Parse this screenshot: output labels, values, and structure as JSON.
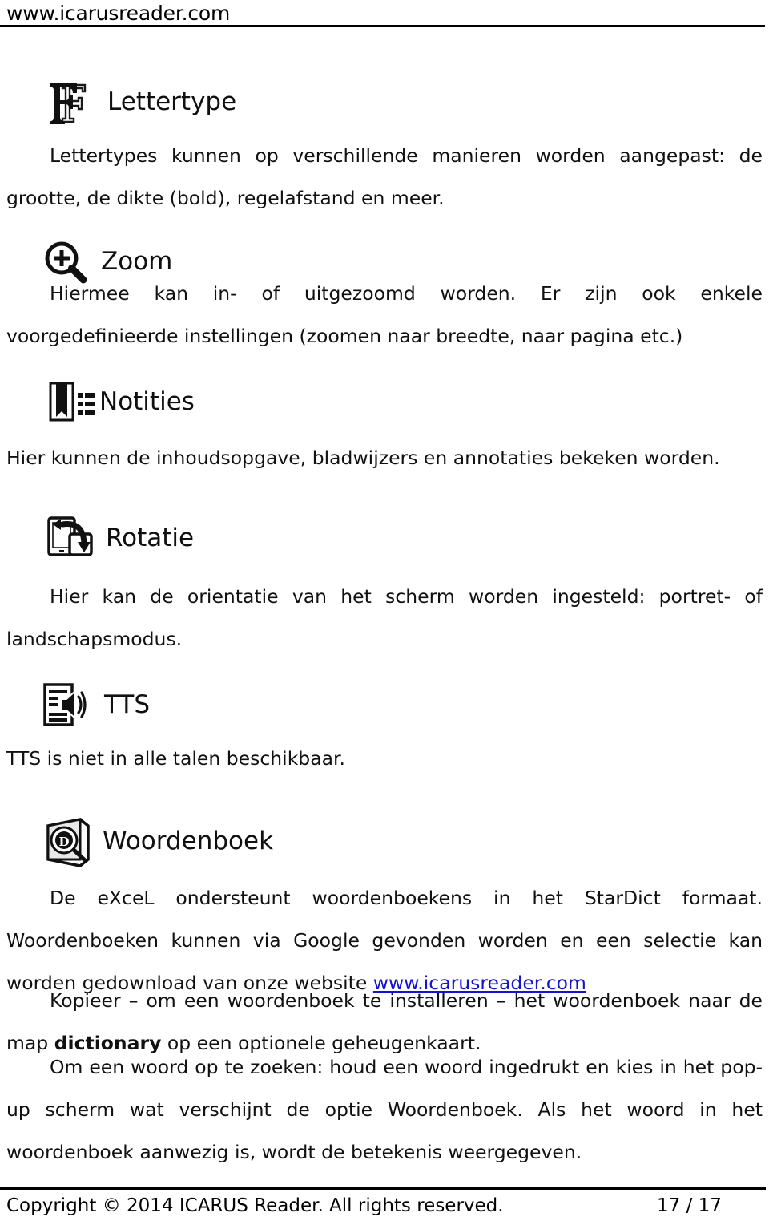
{
  "header": {
    "site": "www.icarusreader.com"
  },
  "sections": [
    {
      "id": "lettertype",
      "icon": "double-f-font-icon",
      "heading": "Lettertype",
      "body": "Lettertypes kunnen op verschillende manieren worden aangepast: de grootte, de dikte (bold), regelafstand en meer."
    },
    {
      "id": "zoom",
      "icon": "magnifier-plus-icon",
      "heading": "Zoom",
      "body": "Hiermee kan in- of uitgezoomd worden. Er zijn ook enkele voorgedefinieerde instellingen (zoomen naar breedte, naar pagina etc.)"
    },
    {
      "id": "notities",
      "icon": "bookmark-list-icon",
      "heading": "Notities",
      "body": "Hier kunnen de inhoudsopgave, bladwijzers en annotaties bekeken worden."
    },
    {
      "id": "rotatie",
      "icon": "screen-rotation-icon",
      "heading": "Rotatie",
      "body": "Hier kan de orientatie van het scherm worden ingesteld: portret- of landschapsmodus."
    },
    {
      "id": "tts",
      "icon": "text-to-speech-icon",
      "heading": "TTS",
      "body": "TTS is niet in alle talen beschikbaar."
    },
    {
      "id": "woordenboek",
      "icon": "dictionary-book-icon",
      "heading": "Woordenboek",
      "body_part1": "De eXceL ondersteunt woordenboekens in het StarDict formaat. Woordenboeken kunnen via Google gevonden worden en een selectie kan worden gedownload van onze website ",
      "link_text": "www.icarusreader.com",
      "para2_part1": "Kopieer – om een woordenboek te installeren – het woordenboek naar de map ",
      "para2_bold": "dictionary",
      "para2_part2": " op een optionele geheugenkaart.",
      "para3": "Om een woord op te zoeken: houd een woord ingedrukt en kies in het pop-up scherm wat verschijnt de optie Woordenboek. Als het woord in het woordenboek aanwezig is, wordt de betekenis weergegeven."
    }
  ],
  "footer": {
    "copyright": "Copyright © 2014 ICARUS Reader. All rights reserved.",
    "page": "17 / 17"
  },
  "colors": {
    "link": "#1414cc",
    "text": "#000000",
    "rule": "#000000"
  }
}
